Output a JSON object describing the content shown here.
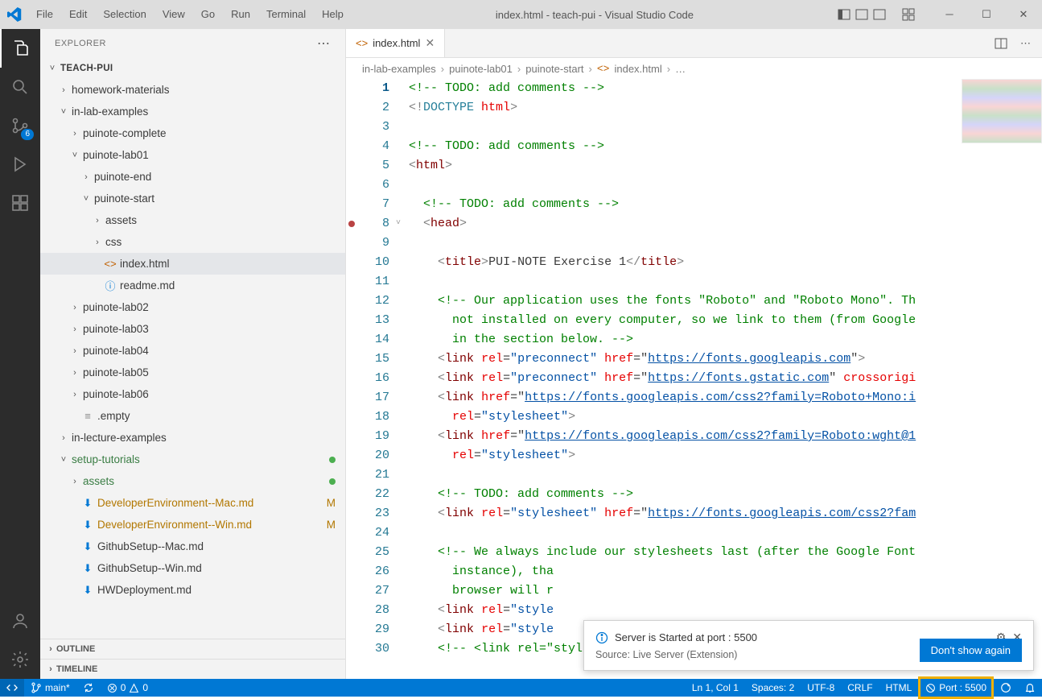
{
  "window": {
    "title": "index.html - teach-pui - Visual Studio Code"
  },
  "menu": [
    "File",
    "Edit",
    "Selection",
    "View",
    "Go",
    "Run",
    "Terminal",
    "Help"
  ],
  "activity": {
    "items": [
      "explorer",
      "search",
      "scm",
      "debug",
      "extensions"
    ],
    "scm_badge": "6"
  },
  "sidebar": {
    "header": "EXPLORER",
    "root": "TEACH-PUI",
    "tree": [
      {
        "indent": 0,
        "twisty": "down",
        "label": "TEACH-PUI",
        "bold": true
      },
      {
        "indent": 1,
        "twisty": "right",
        "label": "homework-materials"
      },
      {
        "indent": 1,
        "twisty": "down",
        "label": "in-lab-examples"
      },
      {
        "indent": 2,
        "twisty": "right",
        "label": "puinote-complete"
      },
      {
        "indent": 2,
        "twisty": "down",
        "label": "puinote-lab01"
      },
      {
        "indent": 3,
        "twisty": "right",
        "label": "puinote-end"
      },
      {
        "indent": 3,
        "twisty": "down",
        "label": "puinote-start"
      },
      {
        "indent": 4,
        "twisty": "right",
        "label": "assets"
      },
      {
        "indent": 4,
        "twisty": "right",
        "label": "css"
      },
      {
        "indent": 4,
        "icon": "code",
        "label": "index.html",
        "selected": true
      },
      {
        "indent": 4,
        "icon": "info",
        "label": "readme.md"
      },
      {
        "indent": 2,
        "twisty": "right",
        "label": "puinote-lab02"
      },
      {
        "indent": 2,
        "twisty": "right",
        "label": "puinote-lab03"
      },
      {
        "indent": 2,
        "twisty": "right",
        "label": "puinote-lab04"
      },
      {
        "indent": 2,
        "twisty": "right",
        "label": "puinote-lab05"
      },
      {
        "indent": 2,
        "twisty": "right",
        "label": "puinote-lab06"
      },
      {
        "indent": 2,
        "icon": "file",
        "label": ".empty"
      },
      {
        "indent": 1,
        "twisty": "right",
        "label": "in-lecture-examples"
      },
      {
        "indent": 1,
        "twisty": "down",
        "label": "setup-tutorials",
        "color": "#3a7d44",
        "dotgreen": true
      },
      {
        "indent": 2,
        "twisty": "right",
        "label": "assets",
        "color": "#3a7d44",
        "dotgreen": true
      },
      {
        "indent": 2,
        "icon": "dl",
        "label": "DeveloperEnvironment--Mac.md",
        "color": "#b27700",
        "m": true
      },
      {
        "indent": 2,
        "icon": "dl",
        "label": "DeveloperEnvironment--Win.md",
        "color": "#b27700",
        "m": true
      },
      {
        "indent": 2,
        "icon": "dl",
        "label": "GithubSetup--Mac.md"
      },
      {
        "indent": 2,
        "icon": "dl",
        "label": "GithubSetup--Win.md"
      },
      {
        "indent": 2,
        "icon": "dl",
        "label": "HWDeployment.md"
      }
    ],
    "outline": "OUTLINE",
    "timeline": "TIMELINE"
  },
  "tabs": [
    {
      "icon": "code",
      "label": "index.html",
      "active": true
    }
  ],
  "breadcrumbs": [
    "in-lab-examples",
    "puinote-lab01",
    "puinote-start",
    "index.html",
    "…"
  ],
  "code": {
    "lines": [
      {
        "n": 1,
        "tokens": [
          {
            "c": "c-cmt",
            "t": "<!-- TODO: add comments -->"
          }
        ]
      },
      {
        "n": 2,
        "tokens": [
          {
            "c": "c-docgrey",
            "t": "<!"
          },
          {
            "c": "c-tagname",
            "t": "DOCTYPE"
          },
          {
            "c": "",
            "t": " "
          },
          {
            "c": "c-attr",
            "t": "html"
          },
          {
            "c": "c-docgrey",
            "t": ">"
          }
        ]
      },
      {
        "n": 3,
        "tokens": []
      },
      {
        "n": 4,
        "tokens": [
          {
            "c": "c-cmt",
            "t": "<!-- TODO: add comments -->"
          }
        ]
      },
      {
        "n": 5,
        "tokens": [
          {
            "c": "c-docgrey",
            "t": "<"
          },
          {
            "c": "c-tag",
            "t": "html"
          },
          {
            "c": "c-docgrey",
            "t": ">"
          }
        ]
      },
      {
        "n": 6,
        "tokens": []
      },
      {
        "n": 7,
        "padtokens": 1,
        "tokens": [
          {
            "c": "c-cmt",
            "t": "<!-- TODO: add comments -->"
          }
        ]
      },
      {
        "n": 8,
        "padtokens": 1,
        "break": true,
        "fold": true,
        "tokens": [
          {
            "c": "c-docgrey",
            "t": "<"
          },
          {
            "c": "c-tag",
            "t": "head"
          },
          {
            "c": "c-docgrey",
            "t": ">"
          }
        ]
      },
      {
        "n": 9,
        "tokens": []
      },
      {
        "n": 10,
        "padtokens": 2,
        "tokens": [
          {
            "c": "c-docgrey",
            "t": "<"
          },
          {
            "c": "c-tag",
            "t": "title"
          },
          {
            "c": "c-docgrey",
            "t": ">"
          },
          {
            "c": "",
            "t": "PUI-NOTE Exercise 1"
          },
          {
            "c": "c-docgrey",
            "t": "</"
          },
          {
            "c": "c-tag",
            "t": "title"
          },
          {
            "c": "c-docgrey",
            "t": ">"
          }
        ]
      },
      {
        "n": 11,
        "tokens": []
      },
      {
        "n": 12,
        "padtokens": 2,
        "tokens": [
          {
            "c": "c-cmt",
            "t": "<!-- Our application uses the fonts \"Roboto\" and \"Roboto Mono\". Th"
          }
        ]
      },
      {
        "n": 13,
        "padtokens": 3,
        "tokens": [
          {
            "c": "c-cmt",
            "t": "not installed on every computer, so we link to them (from Google"
          }
        ]
      },
      {
        "n": 14,
        "padtokens": 3,
        "tokens": [
          {
            "c": "c-cmt",
            "t": "in the section below. -->"
          }
        ]
      },
      {
        "n": 15,
        "padtokens": 2,
        "tokens": [
          {
            "c": "c-docgrey",
            "t": "<"
          },
          {
            "c": "c-tag",
            "t": "link"
          },
          {
            "c": "",
            "t": " "
          },
          {
            "c": "c-attr",
            "t": "rel"
          },
          {
            "c": "",
            "t": "="
          },
          {
            "c": "c-str",
            "t": "\"preconnect\""
          },
          {
            "c": "",
            "t": " "
          },
          {
            "c": "c-attr",
            "t": "href"
          },
          {
            "c": "",
            "t": "=\""
          },
          {
            "c": "c-link",
            "t": "https://fonts.googleapis.com"
          },
          {
            "c": "",
            "t": "\""
          },
          {
            "c": "c-docgrey",
            "t": ">"
          }
        ]
      },
      {
        "n": 16,
        "padtokens": 2,
        "tokens": [
          {
            "c": "c-docgrey",
            "t": "<"
          },
          {
            "c": "c-tag",
            "t": "link"
          },
          {
            "c": "",
            "t": " "
          },
          {
            "c": "c-attr",
            "t": "rel"
          },
          {
            "c": "",
            "t": "="
          },
          {
            "c": "c-str",
            "t": "\"preconnect\""
          },
          {
            "c": "",
            "t": " "
          },
          {
            "c": "c-attr",
            "t": "href"
          },
          {
            "c": "",
            "t": "=\""
          },
          {
            "c": "c-link",
            "t": "https://fonts.gstatic.com"
          },
          {
            "c": "",
            "t": "\" "
          },
          {
            "c": "c-attr",
            "t": "crossorigi"
          }
        ]
      },
      {
        "n": 17,
        "padtokens": 2,
        "tokens": [
          {
            "c": "c-docgrey",
            "t": "<"
          },
          {
            "c": "c-tag",
            "t": "link"
          },
          {
            "c": "",
            "t": " "
          },
          {
            "c": "c-attr",
            "t": "href"
          },
          {
            "c": "",
            "t": "=\""
          },
          {
            "c": "c-link",
            "t": "https://fonts.googleapis.com/css2?family=Roboto+Mono:i"
          }
        ]
      },
      {
        "n": 18,
        "padtokens": 3,
        "tokens": [
          {
            "c": "c-attr",
            "t": "rel"
          },
          {
            "c": "",
            "t": "="
          },
          {
            "c": "c-str",
            "t": "\"stylesheet\""
          },
          {
            "c": "c-docgrey",
            "t": ">"
          }
        ]
      },
      {
        "n": 19,
        "padtokens": 2,
        "tokens": [
          {
            "c": "c-docgrey",
            "t": "<"
          },
          {
            "c": "c-tag",
            "t": "link"
          },
          {
            "c": "",
            "t": " "
          },
          {
            "c": "c-attr",
            "t": "href"
          },
          {
            "c": "",
            "t": "=\""
          },
          {
            "c": "c-link",
            "t": "https://fonts.googleapis.com/css2?family=Roboto:wght@1"
          }
        ]
      },
      {
        "n": 20,
        "padtokens": 3,
        "tokens": [
          {
            "c": "c-attr",
            "t": "rel"
          },
          {
            "c": "",
            "t": "="
          },
          {
            "c": "c-str",
            "t": "\"stylesheet\""
          },
          {
            "c": "c-docgrey",
            "t": ">"
          }
        ]
      },
      {
        "n": 21,
        "tokens": []
      },
      {
        "n": 22,
        "padtokens": 2,
        "tokens": [
          {
            "c": "c-cmt",
            "t": "<!-- TODO: add comments -->"
          }
        ]
      },
      {
        "n": 23,
        "padtokens": 2,
        "tokens": [
          {
            "c": "c-docgrey",
            "t": "<"
          },
          {
            "c": "c-tag",
            "t": "link"
          },
          {
            "c": "",
            "t": " "
          },
          {
            "c": "c-attr",
            "t": "rel"
          },
          {
            "c": "",
            "t": "="
          },
          {
            "c": "c-str",
            "t": "\"stylesheet\""
          },
          {
            "c": "",
            "t": " "
          },
          {
            "c": "c-attr",
            "t": "href"
          },
          {
            "c": "",
            "t": "=\""
          },
          {
            "c": "c-link",
            "t": "https://fonts.googleapis.com/css2?fam"
          }
        ]
      },
      {
        "n": 24,
        "tokens": []
      },
      {
        "n": 25,
        "padtokens": 2,
        "tokens": [
          {
            "c": "c-cmt",
            "t": "<!-- We always include our stylesheets last (after the Google Font"
          }
        ]
      },
      {
        "n": 26,
        "padtokens": 3,
        "tokens": [
          {
            "c": "c-cmt",
            "t": "instance), tha"
          }
        ]
      },
      {
        "n": 27,
        "padtokens": 3,
        "tokens": [
          {
            "c": "c-cmt",
            "t": "browser will r"
          }
        ]
      },
      {
        "n": 28,
        "padtokens": 2,
        "tokens": [
          {
            "c": "c-docgrey",
            "t": "<"
          },
          {
            "c": "c-tag",
            "t": "link"
          },
          {
            "c": "",
            "t": " "
          },
          {
            "c": "c-attr",
            "t": "rel"
          },
          {
            "c": "",
            "t": "="
          },
          {
            "c": "c-str",
            "t": "\"style"
          }
        ]
      },
      {
        "n": 29,
        "padtokens": 2,
        "tokens": [
          {
            "c": "c-docgrey",
            "t": "<"
          },
          {
            "c": "c-tag",
            "t": "link"
          },
          {
            "c": "",
            "t": " "
          },
          {
            "c": "c-attr",
            "t": "rel"
          },
          {
            "c": "",
            "t": "="
          },
          {
            "c": "c-str",
            "t": "\"style"
          }
        ]
      },
      {
        "n": 30,
        "padtokens": 2,
        "tokens": [
          {
            "c": "c-cmt",
            "t": "<!-- <link rel=\"stylesheet\" href=\"css/editor.css\"> -->"
          }
        ]
      }
    ]
  },
  "notification": {
    "message": "Server is Started at port : 5500",
    "source": "Source: Live Server (Extension)",
    "button": "Don't show again"
  },
  "status": {
    "branch": "main*",
    "sync": "",
    "errors": "0",
    "warnings": "0",
    "lncol": "Ln 1, Col 1",
    "spaces": "Spaces: 2",
    "encoding": "UTF-8",
    "eol": "CRLF",
    "lang": "HTML",
    "port": "Port : 5500"
  }
}
